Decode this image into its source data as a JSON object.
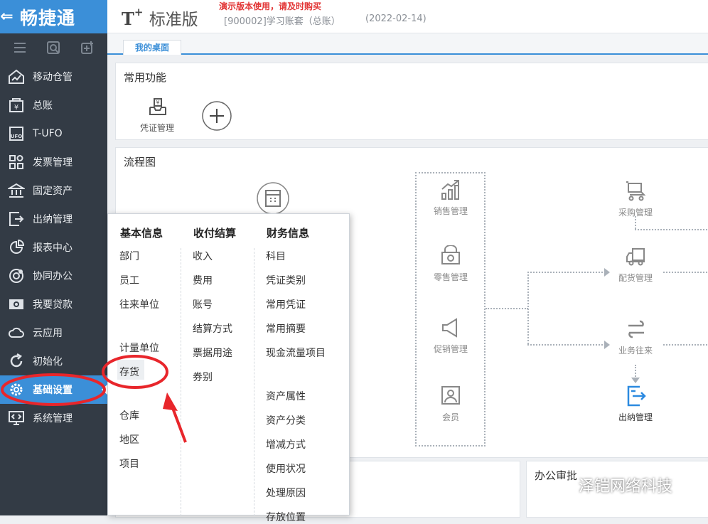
{
  "app": {
    "brand": "畅捷通"
  },
  "header": {
    "logo_text": "标准版",
    "demo_notice": "演示版本使用，请及时购买",
    "account": "[900002]学习账套（总账）",
    "date": "(2022-02-14)"
  },
  "tabs": [
    {
      "label": "我的桌面"
    }
  ],
  "sidebar": {
    "items": [
      {
        "label": "移动仓管",
        "icon": "warehouse-chart-icon"
      },
      {
        "label": "总账",
        "icon": "ledger-icon"
      },
      {
        "label": "T-UFO",
        "icon": "ufo-icon"
      },
      {
        "label": "发票管理",
        "icon": "invoice-grid-icon"
      },
      {
        "label": "固定资产",
        "icon": "bank-building-icon"
      },
      {
        "label": "出纳管理",
        "icon": "cashier-icon"
      },
      {
        "label": "报表中心",
        "icon": "pie-chart-icon"
      },
      {
        "label": "协同办公",
        "icon": "collaboration-icon"
      },
      {
        "label": "我要贷款",
        "icon": "money-bill-icon"
      },
      {
        "label": "云应用",
        "icon": "cloud-icon"
      },
      {
        "label": "初始化",
        "icon": "refresh-icon"
      },
      {
        "label": "基础设置",
        "icon": "gear-settings-icon",
        "active": true
      },
      {
        "label": "系统管理",
        "icon": "monitor-code-icon"
      }
    ]
  },
  "common_functions": {
    "title": "常用功能",
    "items": [
      {
        "label": "凭证管理"
      }
    ],
    "add_icon": "plus-circle-icon"
  },
  "flowchart": {
    "title": "流程图",
    "left_nodes": [
      {
        "label": "销售管理",
        "icon": "growth-chart-icon"
      },
      {
        "label": "零售管理",
        "icon": "retail-store-icon"
      },
      {
        "label": "促销管理",
        "icon": "megaphone-icon"
      },
      {
        "label": "会员",
        "icon": "member-card-icon"
      }
    ],
    "right_nodes": [
      {
        "label": "采购管理",
        "icon": "shopping-cart-icon"
      },
      {
        "label": "配货管理",
        "icon": "delivery-truck-icon"
      },
      {
        "label": "业务往来",
        "icon": "exchange-arrows-icon"
      },
      {
        "label": "出纳管理",
        "icon": "cashier-blue-icon"
      }
    ]
  },
  "office_approval": {
    "title": "办公审批"
  },
  "dropdown": {
    "columns": [
      {
        "header": "基本信息",
        "group1": [
          "部门",
          "员工",
          "往来单位"
        ],
        "group2": [
          "计量单位",
          "存货"
        ],
        "group3": [
          "仓库",
          "地区",
          "项目"
        ]
      },
      {
        "header": "收付结算",
        "group1": [
          "收入",
          "费用",
          "账号",
          "结算方式",
          "票据用途",
          "券别"
        ]
      },
      {
        "header": "财务信息",
        "group1": [
          "科目",
          "凭证类别",
          "常用凭证",
          "常用摘要",
          "现金流量项目"
        ],
        "group2": [
          "资产属性",
          "资产分类",
          "增减方式",
          "使用状况",
          "处理原因",
          "存放位置"
        ]
      }
    ]
  },
  "watermark": "泽铠网络科技",
  "colors": {
    "sidebar_bg": "#333b45",
    "accent": "#3b8fd8",
    "annotation": "#e8262b"
  }
}
